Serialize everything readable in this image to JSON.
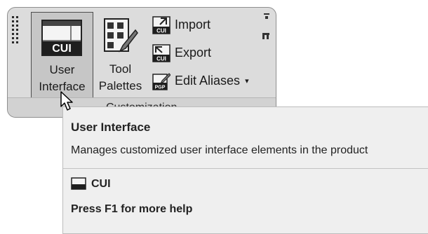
{
  "ribbon_panel": {
    "title": "Customization",
    "user_interface_button": {
      "icon_text": "CUI",
      "label_line1": "User",
      "label_line2": "Interface",
      "icon": "cui-window-icon"
    },
    "tool_palettes_button": {
      "label_line1": "Tool",
      "label_line2": "Palettes",
      "icon": "tool-palettes-icon"
    },
    "import_button": {
      "label": "Import",
      "icon_text": "CUI",
      "icon": "cui-import-icon"
    },
    "export_button": {
      "label": "Export",
      "icon_text": "CUI",
      "icon": "cui-export-icon"
    },
    "edit_aliases_button": {
      "label": "Edit Aliases",
      "icon_text": "PGP",
      "icon": "pgp-icon",
      "dropdown_caret": "▾"
    }
  },
  "tooltip": {
    "title": "User Interface",
    "description": "Manages customized user interface elements in the product",
    "command_name": "CUI",
    "help_text": "Press F1 for more help"
  },
  "colors": {
    "panel_bg": "#dcdcdc",
    "tooltip_bg": "#efefef",
    "selected_button_bg": "#c6c6c6"
  }
}
